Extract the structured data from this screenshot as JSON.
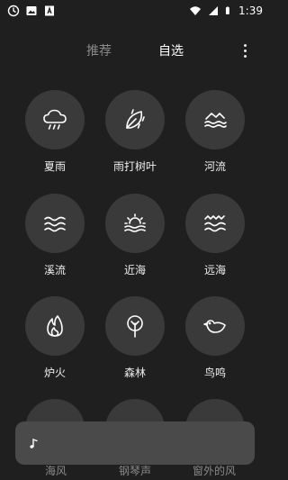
{
  "status": {
    "time": "1:39"
  },
  "tabs": [
    {
      "label": "推荐"
    },
    {
      "label": "自选"
    }
  ],
  "sounds": [
    {
      "label": "夏雨",
      "icon": "rain-cloud-icon"
    },
    {
      "label": "雨打树叶",
      "icon": "rain-leaf-icon"
    },
    {
      "label": "河流",
      "icon": "river-icon"
    },
    {
      "label": "溪流",
      "icon": "stream-icon"
    },
    {
      "label": "近海",
      "icon": "sunrise-sea-icon"
    },
    {
      "label": "远海",
      "icon": "ocean-waves-icon"
    },
    {
      "label": "炉火",
      "icon": "fire-icon"
    },
    {
      "label": "森林",
      "icon": "tree-icon"
    },
    {
      "label": "鸟鸣",
      "icon": "bird-icon"
    }
  ],
  "partial_row": [
    {
      "label": "海风"
    },
    {
      "label": "钢琴声"
    },
    {
      "label": "窗外的风"
    }
  ],
  "player": {
    "icon": "music-note-icon"
  }
}
